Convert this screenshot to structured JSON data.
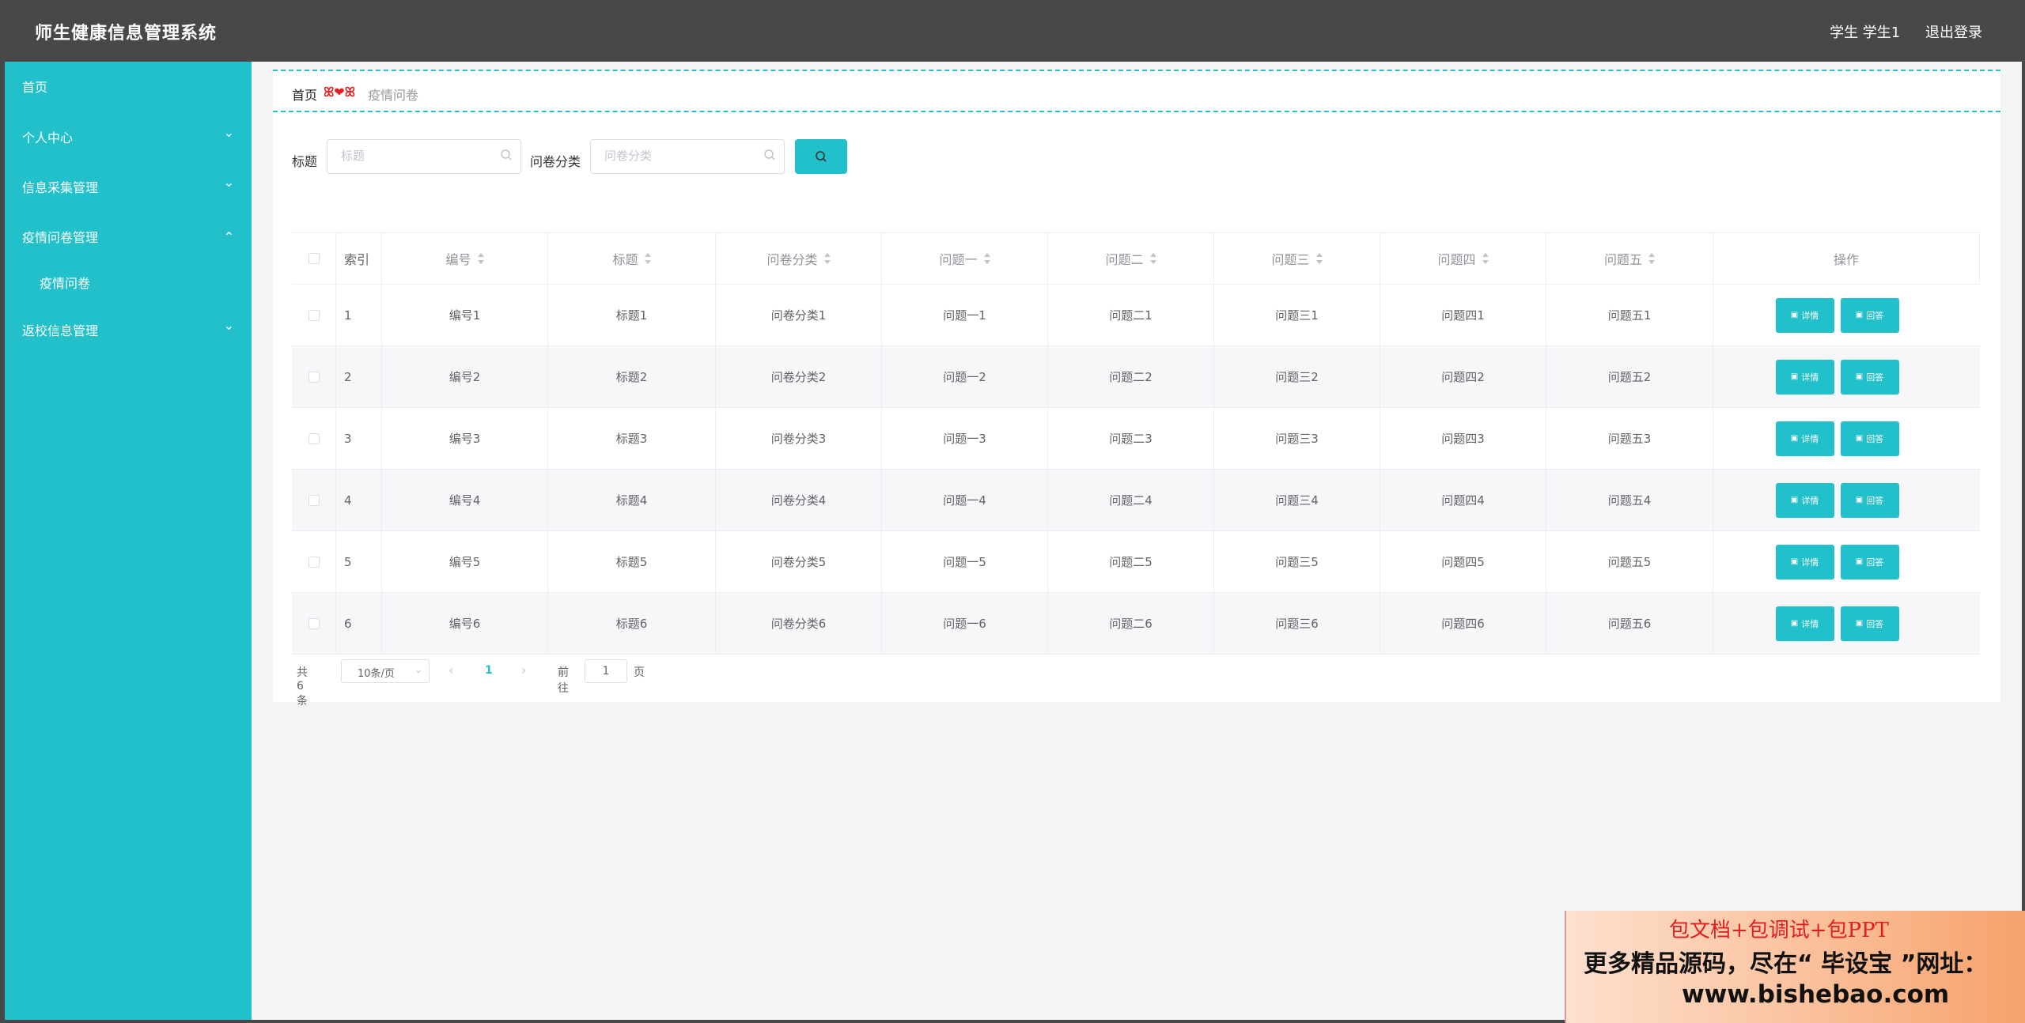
{
  "header": {
    "title": "师生健康信息管理系统",
    "user": "学生 学生1",
    "logout": "退出登录"
  },
  "sidebar": {
    "items": [
      {
        "label": "首页",
        "expandable": false
      },
      {
        "label": "个人中心",
        "expandable": true,
        "expanded": false
      },
      {
        "label": "信息采集管理",
        "expandable": true,
        "expanded": false
      },
      {
        "label": "疫情问卷管理",
        "expandable": true,
        "expanded": true
      },
      {
        "label": "疫情问卷",
        "sub": true
      },
      {
        "label": "返校信息管理",
        "expandable": true,
        "expanded": false
      }
    ]
  },
  "breadcrumb": {
    "home": "首页",
    "separator": "ꕤ❤ꕤ",
    "current": "疫情问卷"
  },
  "search": {
    "title_label": "标题",
    "title_placeholder": "标题",
    "title_value": "",
    "category_label": "问卷分类",
    "category_placeholder": "问卷分类",
    "category_value": ""
  },
  "table": {
    "columns": [
      "索引",
      "编号",
      "标题",
      "问卷分类",
      "问题一",
      "问题二",
      "问题三",
      "问题四",
      "问题五",
      "操作"
    ],
    "sortable": [
      false,
      true,
      true,
      true,
      true,
      true,
      true,
      true,
      true,
      false
    ],
    "rows": [
      [
        "1",
        "编号1",
        "标题1",
        "问卷分类1",
        "问题一1",
        "问题二1",
        "问题三1",
        "问题四1",
        "问题五1"
      ],
      [
        "2",
        "编号2",
        "标题2",
        "问卷分类2",
        "问题一2",
        "问题二2",
        "问题三2",
        "问题四2",
        "问题五2"
      ],
      [
        "3",
        "编号3",
        "标题3",
        "问卷分类3",
        "问题一3",
        "问题二3",
        "问题三3",
        "问题四3",
        "问题五3"
      ],
      [
        "4",
        "编号4",
        "标题4",
        "问卷分类4",
        "问题一4",
        "问题二4",
        "问题三4",
        "问题四4",
        "问题五4"
      ],
      [
        "5",
        "编号5",
        "标题5",
        "问卷分类5",
        "问题一5",
        "问题二5",
        "问题三5",
        "问题四5",
        "问题五5"
      ],
      [
        "6",
        "编号6",
        "标题6",
        "问卷分类6",
        "问题一6",
        "问题二6",
        "问题三6",
        "问题四6",
        "问题五6"
      ]
    ],
    "action_detail": "详情",
    "action_answer": "回答"
  },
  "pagination": {
    "total": "共 6 条",
    "page_size": "10条/页",
    "current_page": "1",
    "goto_label": "前往",
    "goto_value": "1",
    "page_unit": "页"
  },
  "promo": {
    "line1": "包文档+包调试+包PPT",
    "line2": "更多精品源码，尽在“ 毕设宝 ”网址：",
    "line3": "www.bishebao.com"
  },
  "colors": {
    "accent": "#22c0ca",
    "topbar": "#484848",
    "background": "#f4f4f5"
  }
}
